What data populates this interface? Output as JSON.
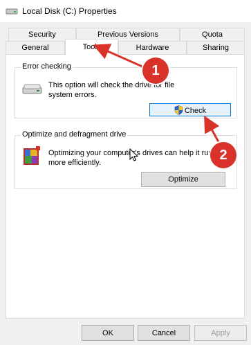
{
  "window": {
    "title": "Local Disk (C:) Properties"
  },
  "tabs": {
    "row1": [
      "Security",
      "Previous Versions",
      "Quota"
    ],
    "row2": [
      "General",
      "Tools",
      "Hardware",
      "Sharing"
    ],
    "active": "Tools"
  },
  "error_checking": {
    "title": "Error checking",
    "description_line1": "This option will check the drive for file",
    "description_line2": "system errors.",
    "button": "Check"
  },
  "optimize": {
    "title": "Optimize and defragment drive",
    "description_line1": "Optimizing your computer's drives can help it run",
    "description_line2": "more efficiently.",
    "button": "Optimize"
  },
  "footer": {
    "ok": "OK",
    "cancel": "Cancel",
    "apply": "Apply"
  },
  "annotations": {
    "step1": "1",
    "step2": "2"
  },
  "colors": {
    "annotation": "#d9322a",
    "focus_border": "#0078d7"
  },
  "icons": [
    "drive-icon",
    "shield-icon",
    "defrag-icon",
    "cursor-icon"
  ]
}
